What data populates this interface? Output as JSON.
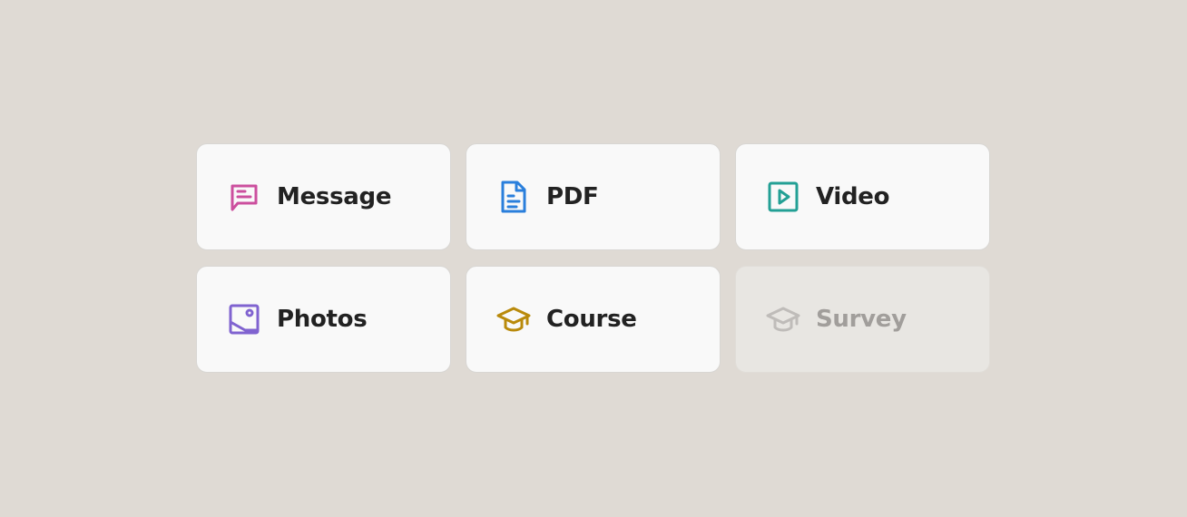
{
  "options": [
    {
      "label": "Message",
      "icon": "message-icon",
      "color": "#cc4f9e",
      "enabled": true
    },
    {
      "label": "PDF",
      "icon": "document-icon",
      "color": "#2a7fdc",
      "enabled": true
    },
    {
      "label": "Video",
      "icon": "play-icon",
      "color": "#23a095",
      "enabled": true
    },
    {
      "label": "Photos",
      "icon": "image-icon",
      "color": "#8063d0",
      "enabled": true
    },
    {
      "label": "Course",
      "icon": "graduation-cap-icon",
      "color": "#b98a0b",
      "enabled": true
    },
    {
      "label": "Survey",
      "icon": "graduation-cap-icon",
      "color": "#bfbcb9",
      "enabled": false
    }
  ]
}
